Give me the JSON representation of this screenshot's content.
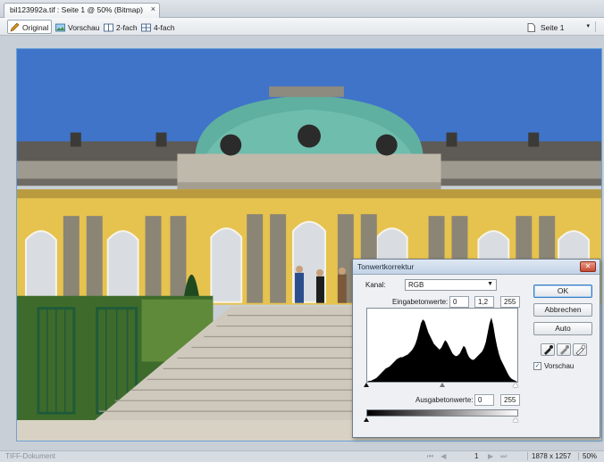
{
  "tab": {
    "title": "bil123992a.tif : Seite 1 @  50% (Bitmap)",
    "close_glyph": "×"
  },
  "toolbar": {
    "items": [
      {
        "label": "Original",
        "icon": "pencil-icon",
        "active": true
      },
      {
        "label": "Vorschau",
        "icon": "preview-image-icon",
        "active": false
      },
      {
        "label": "2-fach",
        "icon": "two-up-icon",
        "active": false
      },
      {
        "label": "4-fach",
        "icon": "four-up-icon",
        "active": false
      }
    ],
    "page_select": {
      "value": "Seite 1",
      "icon": "page-icon"
    }
  },
  "status": {
    "doc_label": "TIFF-Dokument",
    "page": "1",
    "dimensions": "1878 x 1257",
    "zoom": "50%"
  },
  "dialog": {
    "title": "Tonwertkorrektur",
    "close_glyph": "✕",
    "kanal_label": "Kanal:",
    "kanal_value": "RGB",
    "input_label": "Eingabetonwerte:",
    "input_black": "0",
    "input_gamma": "1,2",
    "input_white": "255",
    "output_label": "Ausgabetonwerte:",
    "output_black": "0",
    "output_white": "255",
    "buttons": {
      "ok": "OK",
      "cancel": "Abbrechen",
      "auto": "Auto"
    },
    "preview_label": "Vorschau",
    "preview_checked": true,
    "histogram": [
      0,
      1,
      1,
      2,
      3,
      4,
      6,
      8,
      10,
      12,
      14,
      15,
      16,
      18,
      20,
      22,
      24,
      25,
      26,
      26,
      27,
      28,
      29,
      31,
      33,
      36,
      40,
      46,
      54,
      62,
      66,
      64,
      58,
      52,
      48,
      44,
      40,
      38,
      36,
      34,
      36,
      40,
      44,
      42,
      38,
      34,
      30,
      28,
      27,
      28,
      30,
      34,
      38,
      36,
      30,
      26,
      24,
      23,
      24,
      26,
      28,
      30,
      32,
      36,
      42,
      52,
      62,
      68,
      60,
      48,
      38,
      30,
      24,
      20,
      16,
      12,
      8,
      5,
      3,
      2,
      1,
      0
    ]
  }
}
